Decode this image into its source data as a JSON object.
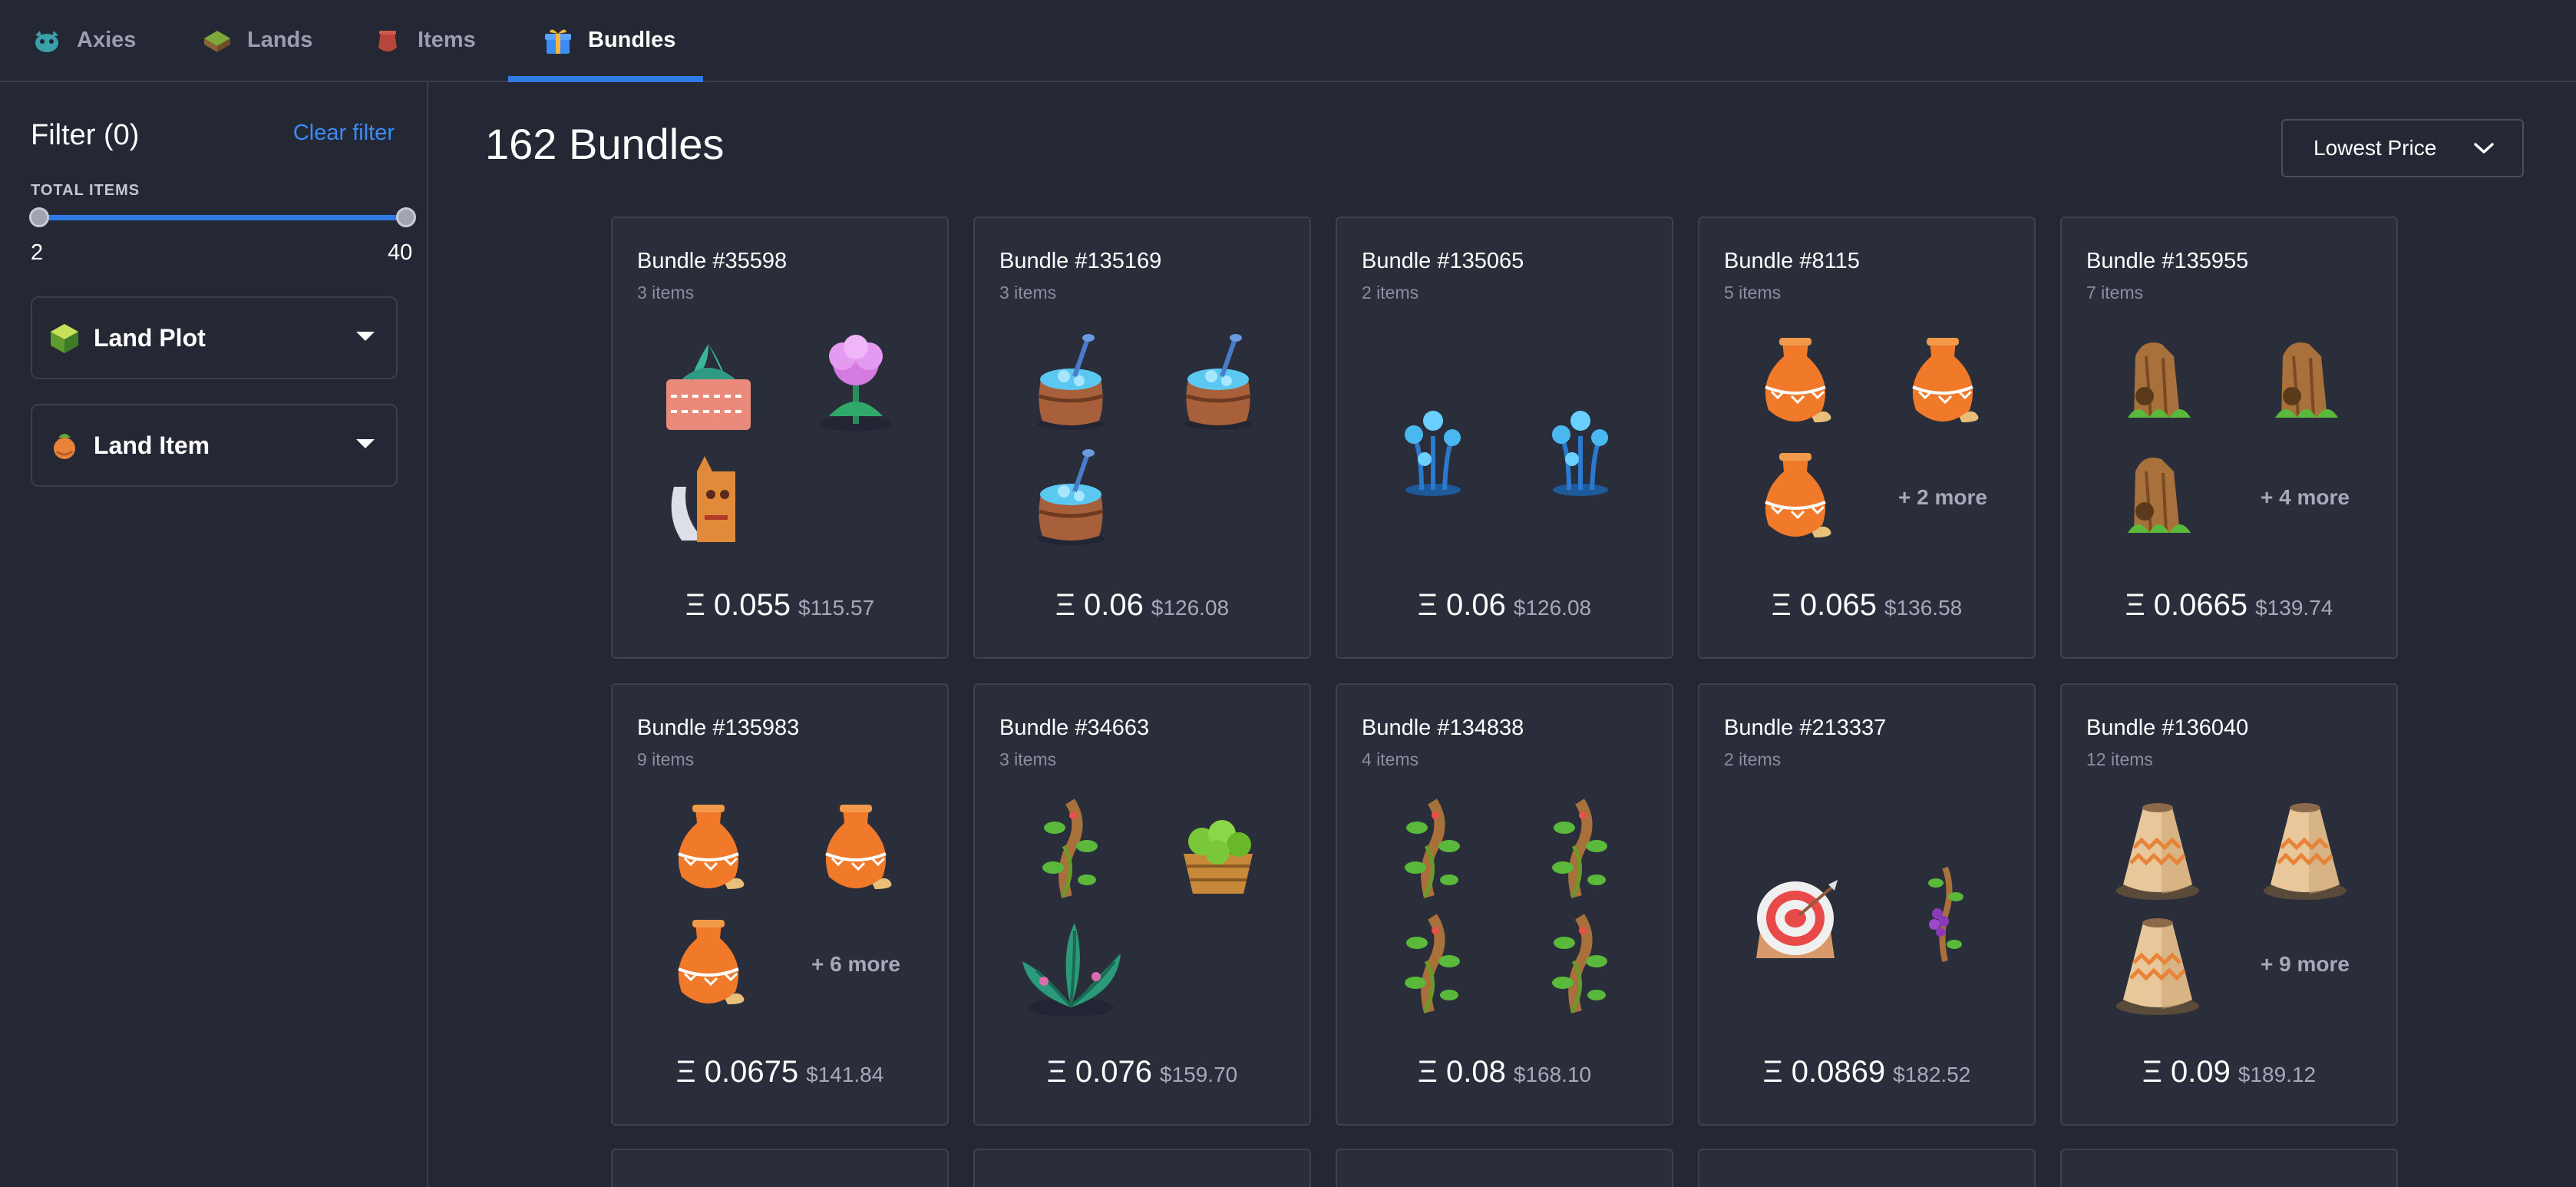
{
  "nav": {
    "tabs": [
      {
        "label": "Axies",
        "icon": "axie-icon",
        "active": false
      },
      {
        "label": "Lands",
        "icon": "land-icon",
        "active": false
      },
      {
        "label": "Items",
        "icon": "item-icon",
        "active": false
      },
      {
        "label": "Bundles",
        "icon": "gift-icon",
        "active": true
      }
    ],
    "accent": "#2f7be6"
  },
  "sidebar": {
    "filter_title": "Filter (0)",
    "clear_filter": "Clear filter",
    "total_items": {
      "label": "TOTAL ITEMS",
      "min": "2",
      "max": "40",
      "low": 2,
      "high": 40
    },
    "accordions": [
      {
        "label": "Land Plot",
        "icon": "land-plot-icon"
      },
      {
        "label": "Land Item",
        "icon": "land-item-icon"
      }
    ]
  },
  "main": {
    "count_label": "162 Bundles",
    "sort": {
      "selected": "Lowest Price"
    },
    "bundles": [
      {
        "title": "Bundle #35598",
        "count": "3 items",
        "eth": "Ξ 0.055",
        "usd": "$115.57",
        "items": [
          "succulent-pot-icon",
          "pink-flower-icon",
          "feathered-totem-icon"
        ],
        "more": ""
      },
      {
        "title": "Bundle #135169",
        "count": "3 items",
        "eth": "Ξ 0.06",
        "usd": "$126.08",
        "items": [
          "water-barrel-icon",
          "water-barrel-icon",
          "water-barrel-icon"
        ],
        "more": ""
      },
      {
        "title": "Bundle #135065",
        "count": "2 items",
        "eth": "Ξ 0.06",
        "usd": "$126.08",
        "items": [
          "blue-flower-icon",
          "blue-flower-icon"
        ],
        "more": ""
      },
      {
        "title": "Bundle #8115",
        "count": "5 items",
        "eth": "Ξ 0.065",
        "usd": "$136.58",
        "items": [
          "orange-vase-icon",
          "orange-vase-icon",
          "orange-vase-icon"
        ],
        "more": "+ 2 more"
      },
      {
        "title": "Bundle #135955",
        "count": "7 items",
        "eth": "Ξ 0.0665",
        "usd": "$139.74",
        "items": [
          "stump-icon",
          "stump-icon",
          "stump-icon"
        ],
        "more": "+ 4 more"
      },
      {
        "title": "Bundle #135983",
        "count": "9 items",
        "eth": "Ξ 0.0675",
        "usd": "$141.84",
        "items": [
          "orange-vase-icon",
          "orange-vase-icon",
          "orange-vase-icon"
        ],
        "more": "+ 6 more"
      },
      {
        "title": "Bundle #34663",
        "count": "3 items",
        "eth": "Ξ 0.076",
        "usd": "$159.70",
        "items": [
          "beanstalk-icon",
          "fruit-basket-icon",
          "leafy-plant-icon"
        ],
        "more": ""
      },
      {
        "title": "Bundle #134838",
        "count": "4 items",
        "eth": "Ξ 0.08",
        "usd": "$168.10",
        "items": [
          "beanstalk-icon",
          "beanstalk-icon",
          "beanstalk-icon",
          "beanstalk-icon"
        ],
        "more": ""
      },
      {
        "title": "Bundle #213337",
        "count": "2 items",
        "eth": "Ξ 0.0869",
        "usd": "$182.52",
        "items": [
          "target-stump-icon",
          "grape-vine-icon"
        ],
        "more": ""
      },
      {
        "title": "Bundle #136040",
        "count": "12 items",
        "eth": "Ξ 0.09",
        "usd": "$189.12",
        "items": [
          "clay-vase-icon",
          "clay-vase-icon",
          "clay-vase-icon"
        ],
        "more": "+ 9 more"
      }
    ]
  },
  "colors": {
    "background": "#242734",
    "card": "#2a2d3a",
    "border": "#3d4152",
    "link": "#3b8cf5"
  }
}
